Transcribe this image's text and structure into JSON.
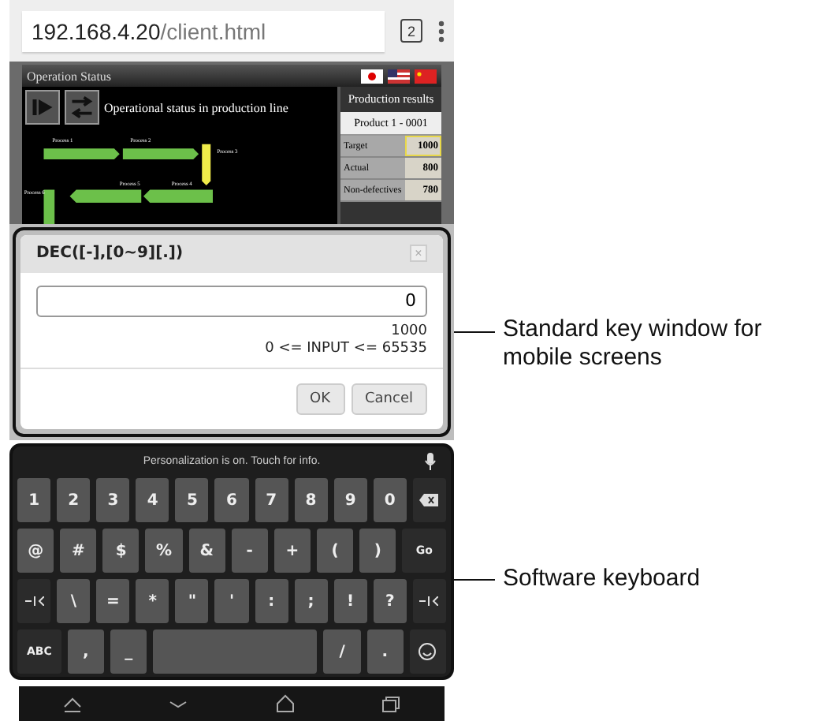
{
  "browser": {
    "url_host": "192.168.4.20",
    "url_path": "/client.html",
    "tab_count": "2"
  },
  "hmi": {
    "title": "Operation Status",
    "heading": "Operational status in production line",
    "processes": [
      {
        "label": "Process 1",
        "color": "#6cc04a"
      },
      {
        "label": "Process 2",
        "color": "#6cc04a"
      },
      {
        "label": "Process 3",
        "color": "#f0ec4a"
      },
      {
        "label": "Process 4",
        "color": "#6cc04a"
      },
      {
        "label": "Process 5",
        "color": "#6cc04a"
      },
      {
        "label": "Process 6",
        "color": "#6cc04a"
      }
    ],
    "results": {
      "title": "Production results",
      "product": "Product 1 - 0001",
      "rows": [
        {
          "label": "Target",
          "value": "1000",
          "highlighted": true
        },
        {
          "label": "Actual",
          "value": "800",
          "highlighted": false
        },
        {
          "label": "Non-defectives",
          "value": "780",
          "highlighted": false
        }
      ]
    }
  },
  "dialog": {
    "title": "DEC([-],[0~9][.])",
    "close": "×",
    "value": "0",
    "current": "1000",
    "range": "0 <= INPUT <= 65535",
    "buttons": [
      "OK",
      "Cancel"
    ]
  },
  "keyboard": {
    "hint": "Personalization is on. Touch for info.",
    "rows": [
      [
        {
          "kind": "char",
          "label": "1"
        },
        {
          "kind": "char",
          "label": "2"
        },
        {
          "kind": "char",
          "label": "3"
        },
        {
          "kind": "char",
          "label": "4"
        },
        {
          "kind": "char",
          "label": "5"
        },
        {
          "kind": "char",
          "label": "6"
        },
        {
          "kind": "char",
          "label": "7"
        },
        {
          "kind": "char",
          "label": "8"
        },
        {
          "kind": "char",
          "label": "9"
        },
        {
          "kind": "char",
          "label": "0"
        },
        {
          "kind": "backspace"
        }
      ],
      [
        {
          "kind": "char",
          "label": "@"
        },
        {
          "kind": "char",
          "label": "#"
        },
        {
          "kind": "char",
          "label": "$"
        },
        {
          "kind": "char",
          "label": "%"
        },
        {
          "kind": "char",
          "label": "&"
        },
        {
          "kind": "char",
          "label": "-"
        },
        {
          "kind": "char",
          "label": "+"
        },
        {
          "kind": "char",
          "label": "("
        },
        {
          "kind": "char",
          "label": ")"
        },
        {
          "kind": "action",
          "label": "Go"
        }
      ],
      [
        {
          "kind": "tab"
        },
        {
          "kind": "char",
          "label": "\\"
        },
        {
          "kind": "char",
          "label": "="
        },
        {
          "kind": "char",
          "label": "*"
        },
        {
          "kind": "char",
          "label": "\""
        },
        {
          "kind": "char",
          "label": "'"
        },
        {
          "kind": "char",
          "label": ":"
        },
        {
          "kind": "char",
          "label": ";"
        },
        {
          "kind": "char",
          "label": "!"
        },
        {
          "kind": "char",
          "label": "?"
        },
        {
          "kind": "tab"
        }
      ],
      [
        {
          "kind": "action",
          "label": "ABC"
        },
        {
          "kind": "char",
          "label": ","
        },
        {
          "kind": "char",
          "label": "_"
        },
        {
          "kind": "space"
        },
        {
          "kind": "char",
          "label": "/"
        },
        {
          "kind": "char",
          "label": "."
        },
        {
          "kind": "emoji"
        }
      ]
    ]
  },
  "annotations": [
    {
      "text": "Standard key window for mobile screens"
    },
    {
      "text": "Software keyboard"
    }
  ]
}
